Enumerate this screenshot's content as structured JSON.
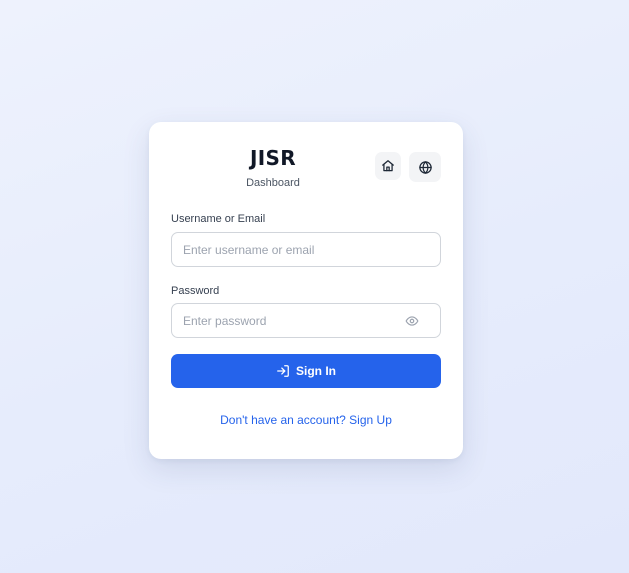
{
  "brand": {
    "title": "JISR",
    "subtitle": "Dashboard"
  },
  "header_actions": {
    "home_icon": "home-icon",
    "language_icon": "globe-icon"
  },
  "form": {
    "username_label": "Username or Email",
    "username_placeholder": "Enter username or email",
    "username_value": "",
    "password_label": "Password",
    "password_placeholder": "Enter password",
    "password_value": "",
    "password_toggle_icon": "eye-icon",
    "submit_label": "Sign In",
    "submit_icon": "sign-in-icon",
    "signup_link": "Don't have an account? Sign Up"
  },
  "colors": {
    "primary": "#2563eb",
    "background": "#e9eefc",
    "card": "#ffffff",
    "heading": "#111827"
  }
}
